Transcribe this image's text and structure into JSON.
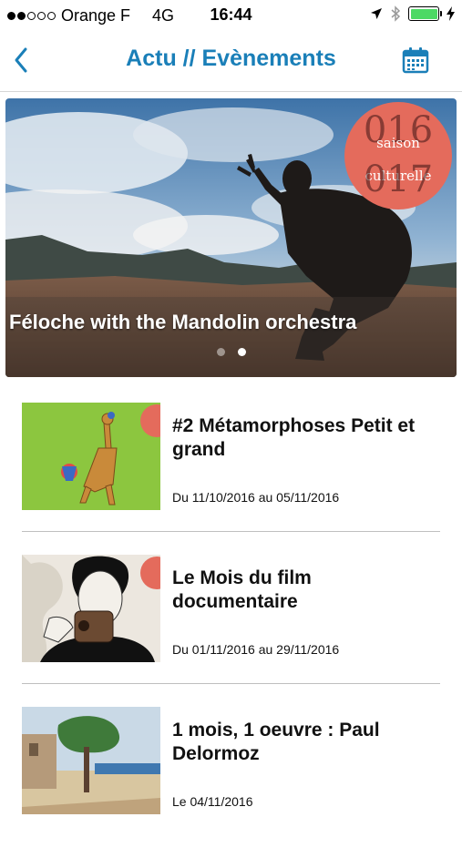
{
  "status_bar": {
    "carrier": "Orange F",
    "network": "4G",
    "time": "16:44"
  },
  "nav": {
    "title": "Actu // Evènements",
    "back_icon": "chevron-left-icon",
    "calendar_icon": "calendar-icon",
    "accent_color": "#1a7fb8"
  },
  "hero": {
    "title": "Féloche with the Mandolin orchestra",
    "badge_top": "016",
    "badge_line1": "saison",
    "badge_line2": "culturelle",
    "badge_bottom": "017",
    "pages": 2,
    "active_page": 2
  },
  "events": [
    {
      "title": "#2 Métamorphoses Petit et grand",
      "date": "Du 11/10/2016 au 05/11/2016"
    },
    {
      "title": "Le Mois du film documentaire",
      "date": "Du 01/11/2016 au 29/11/2016"
    },
    {
      "title": "1 mois, 1 oeuvre : Paul Delormoz",
      "date": "Le 04/11/2016"
    }
  ]
}
